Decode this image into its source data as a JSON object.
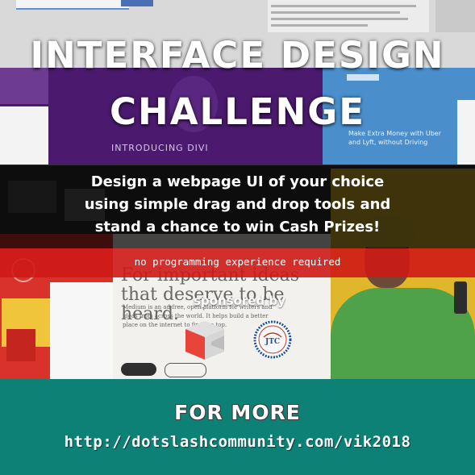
{
  "poster": {
    "title_line1": "INTERFACE DESIGN",
    "title_line2": "CHALLENGE",
    "tagline": [
      "Design a webpage UI of your choice",
      "using simple drag and drop tools and",
      "stand a chance to win Cash Prizes!"
    ],
    "requirement": "no programming experience required",
    "sponsored_by": "sponsored by",
    "sponsor_seal_text": "JTC"
  },
  "background_collage": {
    "divi_banner_text": "INTRODUCING DIVI",
    "blue_site_text": "Make Extra Money with Uber and Lyft, without Driving",
    "medium_headline": "For important ideas that deserve to be heard.",
    "medium_body": "Medium is an ad-free, open platform for writers and ideas from across the world. It helps build a better place on the internet to find the top."
  },
  "footer": {
    "heading": "FOR MORE",
    "url": "http://dotslashcommunity.com/vik2018"
  },
  "colors": {
    "footer_bg": "#0e8177",
    "red_band": "#ce1a16",
    "dark_band": "#000000",
    "logo_red": "#e8443a",
    "logo_gray": "#d9d9d9",
    "seal_blue": "#1d4fa0"
  },
  "icons": {
    "sponsor_logo_1": "cube-logo-icon",
    "sponsor_logo_2": "seal-logo-icon"
  }
}
